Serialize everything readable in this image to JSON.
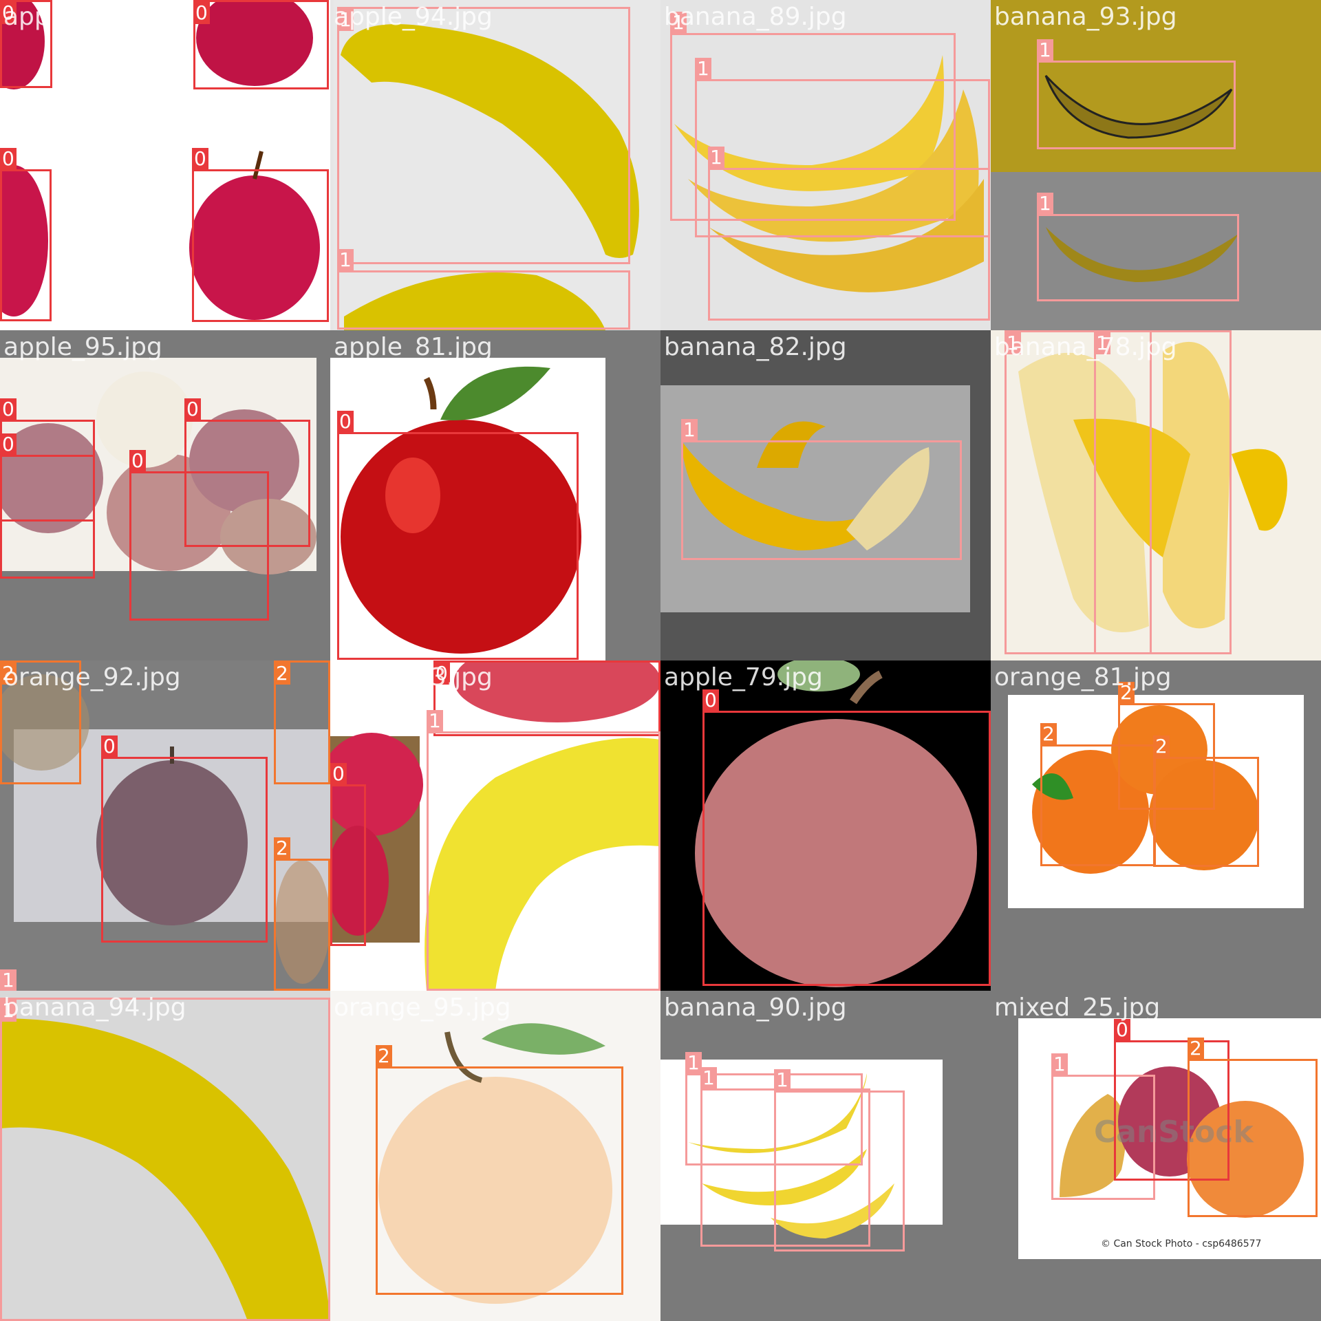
{
  "colors": {
    "class_0": "#e8383b",
    "class_1": "#f59a9a",
    "class_2": "#f2762e"
  },
  "tiles": [
    {
      "label": "apple_80.jpg",
      "subject": "apple",
      "bg": "#ffffff",
      "boxes": [
        {
          "cls": "0"
        },
        {
          "cls": "0"
        },
        {
          "cls": "0"
        },
        {
          "cls": "0"
        }
      ]
    },
    {
      "label": "apple_94.jpg",
      "subject": "banana-toy",
      "bg": "#e6e6e6",
      "boxes": [
        {
          "cls": "1"
        },
        {
          "cls": "1"
        }
      ]
    },
    {
      "label": "banana_89.jpg",
      "subject": "banana-bunch",
      "bg": "#e4e4e4",
      "boxes": [
        {
          "cls": "1"
        },
        {
          "cls": "1"
        },
        {
          "cls": "1"
        }
      ]
    },
    {
      "label": "banana_93.jpg",
      "subject": "banana-illustration",
      "bg": "#8c8c8c",
      "boxes": [
        {
          "cls": "1"
        },
        {
          "cls": "1"
        }
      ]
    },
    {
      "label": "apple_95.jpg",
      "subject": "apple-pile",
      "bg": "#7a7a7a",
      "boxes": [
        {
          "cls": "0"
        },
        {
          "cls": "0"
        },
        {
          "cls": "0"
        },
        {
          "cls": "0"
        }
      ]
    },
    {
      "label": "apple_81.jpg",
      "subject": "red-apple",
      "bg": "#7a7a7a",
      "boxes": [
        {
          "cls": "0"
        }
      ]
    },
    {
      "label": "banana_82.jpg",
      "subject": "peeled-banana",
      "bg": "#555555",
      "boxes": [
        {
          "cls": "1"
        }
      ]
    },
    {
      "label": "banana_78.jpg",
      "subject": "banana-peel-art",
      "bg": "#f4f0e6",
      "boxes": [
        {
          "cls": "1"
        },
        {
          "cls": "1"
        }
      ]
    },
    {
      "label": "orange_92.jpg",
      "subject": "apple-faded",
      "bg": "#7e7e7e",
      "boxes": [
        {
          "cls": "2"
        },
        {
          "cls": "2"
        },
        {
          "cls": "0"
        },
        {
          "cls": "2"
        },
        {
          "cls": "1"
        }
      ]
    },
    {
      "label": "apple_83.jpg",
      "subject": "apples-banana",
      "bg": "#ffffff",
      "boxes": [
        {
          "cls": "0"
        },
        {
          "cls": "1"
        },
        {
          "cls": "0"
        }
      ]
    },
    {
      "label": "apple_79.jpg",
      "subject": "pink-apple",
      "bg": "#7a7a7a",
      "boxes": [
        {
          "cls": "0"
        }
      ]
    },
    {
      "label": "orange_81.jpg",
      "subject": "oranges",
      "bg": "#7a7a7a",
      "boxes": [
        {
          "cls": "2"
        },
        {
          "cls": "2"
        },
        {
          "cls": "2"
        }
      ]
    },
    {
      "label": "banana_94.jpg",
      "subject": "banana-closeup",
      "bg": "#d8d8d8",
      "boxes": [
        {
          "cls": "1"
        }
      ]
    },
    {
      "label": "orange_95.jpg",
      "subject": "pale-orange",
      "bg": "#f7f5f2",
      "boxes": [
        {
          "cls": "2"
        }
      ]
    },
    {
      "label": "banana_90.jpg",
      "subject": "small-bananas",
      "bg": "#7a7a7a",
      "boxes": [
        {
          "cls": "1"
        },
        {
          "cls": "1"
        },
        {
          "cls": "1"
        }
      ]
    },
    {
      "label": "mixed_25.jpg",
      "subject": "mixed-fruit",
      "bg": "#7a7a7a",
      "watermark": "CanStock",
      "caption": "© Can Stock Photo - csp6486577",
      "boxes": [
        {
          "cls": "1"
        },
        {
          "cls": "0"
        },
        {
          "cls": "2"
        }
      ]
    }
  ]
}
